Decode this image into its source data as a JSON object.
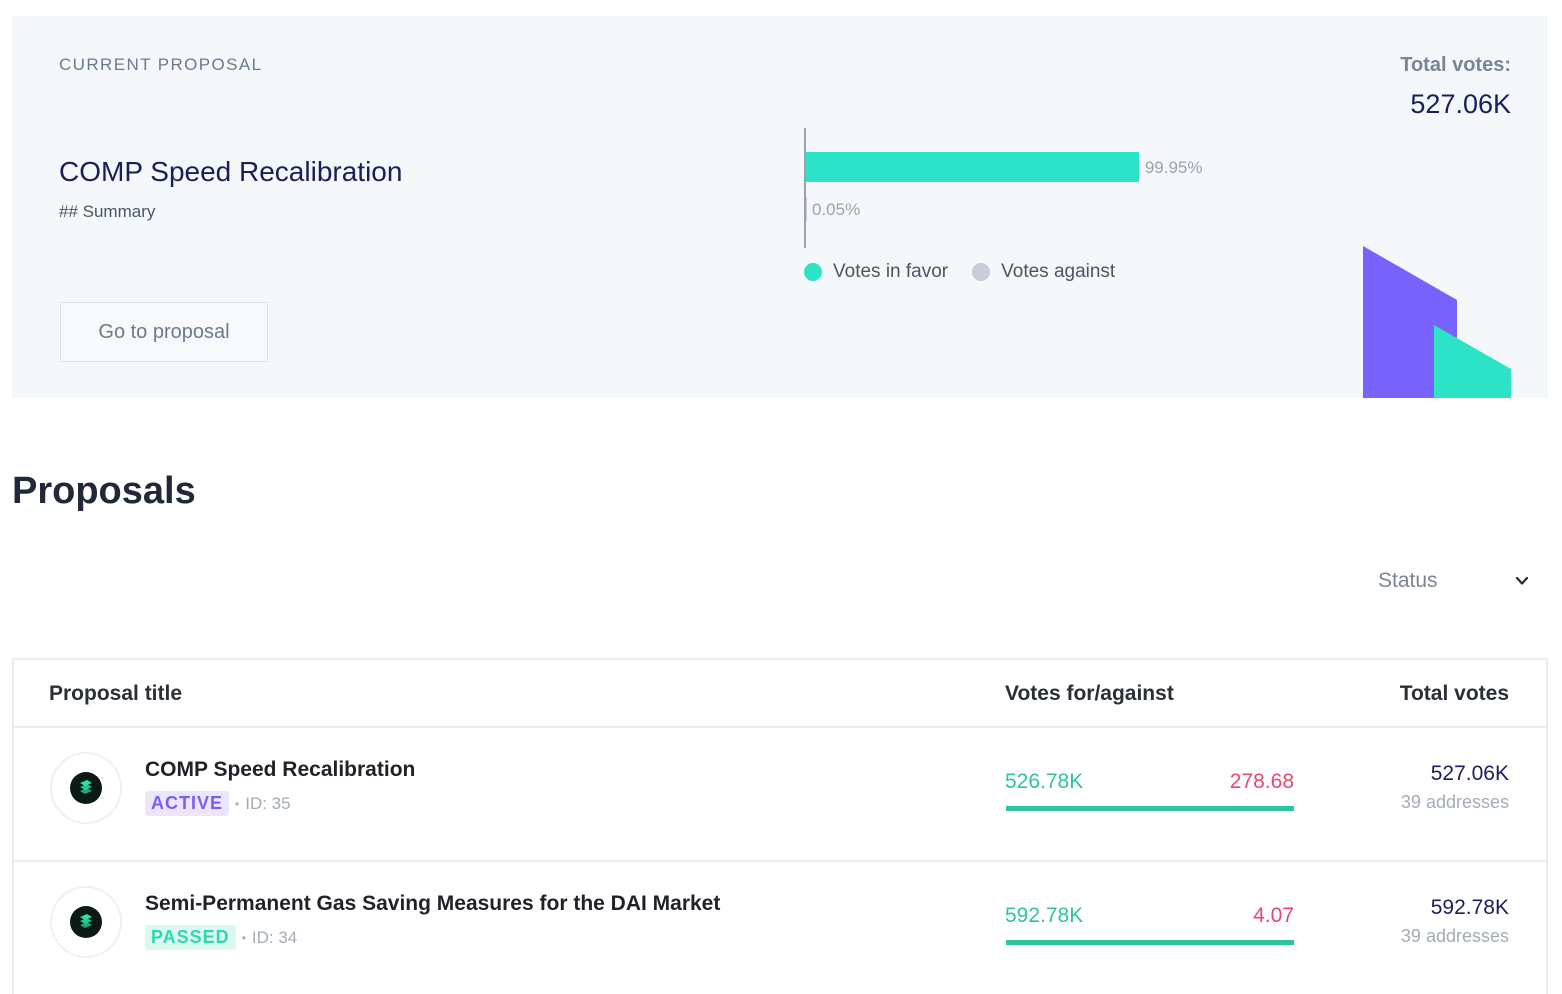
{
  "current_proposal": {
    "label": "CURRENT PROPOSAL",
    "title": "COMP Speed Recalibration",
    "summary": "## Summary",
    "button_label": "Go to proposal",
    "total_votes_label": "Total votes:",
    "total_votes_value": "527.06K",
    "chart_data": {
      "type": "bar",
      "orientation": "horizontal",
      "categories": [
        "Votes in favor",
        "Votes against"
      ],
      "values": [
        99.95,
        0.05
      ],
      "value_labels": [
        "99.95%",
        "0.05%"
      ],
      "colors": [
        "#2ce3c7",
        "#c7ced8"
      ],
      "xlim": [
        0,
        100
      ],
      "legend": "bottom-left"
    },
    "legend": [
      {
        "label": "Votes in favor",
        "color": "#2ce3c7"
      },
      {
        "label": "Votes against",
        "color": "#c7ced8"
      }
    ]
  },
  "proposals": {
    "heading": "Proposals",
    "status_filter": {
      "label": "Status",
      "icon": "chevron-down-icon"
    },
    "columns": [
      "Proposal title",
      "Votes for/against",
      "Total votes"
    ],
    "rows": [
      {
        "title": "COMP Speed Recalibration",
        "status": "ACTIVE",
        "status_color": "#7b5cf5",
        "separator": "•",
        "id_text": "ID: 35",
        "votes_for": "526.78K",
        "votes_against": "278.68",
        "for_fraction": 0.9995,
        "total_votes": "527.06K",
        "addresses": "39 addresses",
        "icon": "compound-logo-icon"
      },
      {
        "title": "Semi-Permanent Gas Saving Measures for the DAI Market",
        "status": "PASSED",
        "status_color": "#2fd6b0",
        "separator": "•",
        "id_text": "ID: 34",
        "votes_for": "592.78K",
        "votes_against": "4.07",
        "for_fraction": 1.0,
        "total_votes": "592.78K",
        "addresses": "39 addresses",
        "icon": "compound-logo-icon"
      }
    ]
  }
}
